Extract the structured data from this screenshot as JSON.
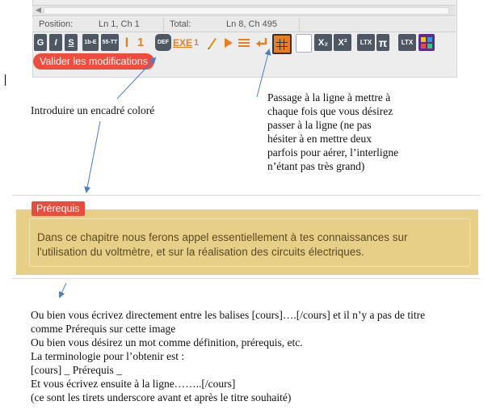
{
  "editor": {
    "status": {
      "position_label": "Position:",
      "position_value": "Ln 1, Ch 1",
      "total_label": "Total:",
      "total_value": "Ln 8, Ch 495"
    },
    "toolbar": {
      "bold": "G",
      "italic": "I",
      "strike": "S",
      "btn_1b": "1b-E",
      "btn_55": "55-TT",
      "cursor_glyph": "I",
      "one": "1",
      "def": "DEF",
      "exe": "EXE",
      "exe_sub": "1",
      "sub": "X₂",
      "sup": "X²",
      "latex": "LTX",
      "pi": "π",
      "ltx2": "LTX"
    },
    "validate_label": "Valider les modifications"
  },
  "annotations": {
    "left": "Introduire un encadré coloré",
    "right": [
      "Passage à la ligne à mettre à",
      "chaque fois que vous désirez",
      "passer à la ligne (ne pas",
      "hésiter à en mettre deux",
      "parfois pour aérer, l’interligne",
      "n’étant pas très grand)"
    ]
  },
  "prerequis": {
    "tag": "Prérequis",
    "text_lines": [
      "Dans ce chapitre nous ferons appel essentiellement à tes connaissances sur",
      "l'utilisation du voltmètre, et sur la réalisation des circuits électriques."
    ]
  },
  "instructions": [
    "Ou bien vous écrivez directement entre les balises [cours]….[/cours] et il n’y a pas de titre",
    "comme Prérequis sur cette image",
    "Ou bien vous désirez un mot comme définition, prérequis, etc.",
    "La terminologie pour l’obtenir est :",
    "[cours] _ Prérequis _",
    "Et vous écrivez ensuite à la ligne……..[/cours]",
    "(ce sont les tirets underscore avant et après le titre souhaité)"
  ],
  "colors": {
    "accent_red": "#e74c3c",
    "toolbar_dark": "#4d5863",
    "toolbar_orange": "#e67e22",
    "prereq_bg": "#e8cf87",
    "arrow_blue": "#4a7fc1"
  }
}
